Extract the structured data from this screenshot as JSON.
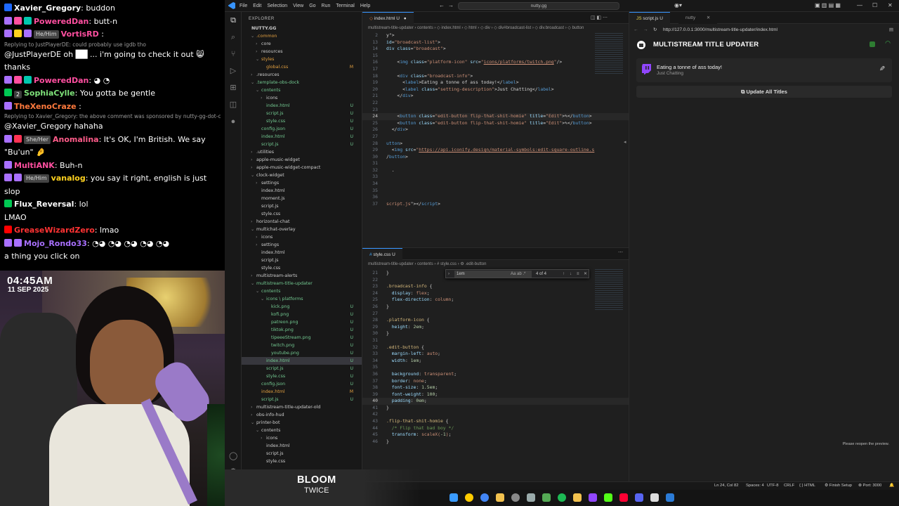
{
  "chat": {
    "messages": [
      {
        "user": "Xavier_Gregory",
        "color": "#ffffff",
        "text": ": buddon",
        "badges": [
          "#1e69ff"
        ]
      },
      {
        "user": "PoweredDan",
        "color": "#ff4fa0",
        "text": ": butt-n",
        "badges": [
          "#a970ff",
          "#ff4fa0",
          "#00c8af"
        ]
      },
      {
        "user": "VortisRD",
        "color": "#ff4fa0",
        "text": " :",
        "badges": [
          "#a970ff",
          "#ffd21f",
          "#a970ff"
        ],
        "pronoun": "He/Him"
      },
      {
        "reply": "Replying to JustPlayerDE: could probably use igdb tho"
      },
      {
        "plain": "@JustPlayerDE oh ██ ... i'm going to check it out 😸 thanks"
      },
      {
        "user": "PoweredDan",
        "color": "#ff4fa0",
        "text": ": ◕ ◔",
        "badges": [
          "#a970ff",
          "#ff4fa0",
          "#00c8af"
        ]
      },
      {
        "user": "SophiaCylle",
        "color": "#7fe37a",
        "text": ": You gotta be gentle",
        "badges": [
          "#00c853",
          "#3d3d3d"
        ],
        "badge_text": "2"
      },
      {
        "user": "TheXenoCraze",
        "color": "#ff7a3d",
        "text": " :",
        "badges": [
          "#a970ff"
        ]
      },
      {
        "reply": "Replying to Xavier_Gregory: the above comment was sponsored by nutty-gg-dot-com-dot-org-dot-dott"
      },
      {
        "plain": "@Xavier_Gregory hahaha"
      },
      {
        "user": "Anomalina",
        "color": "#ff5c8a",
        "text": ": It's OK, I'm British. We say \"Bu'un\" 🤌",
        "badges": [
          "#a970ff",
          "#ff3355"
        ],
        "pronoun": "She/Her"
      },
      {
        "user": "MultiANK",
        "color": "#ff4fa0",
        "text": ": Buh-n",
        "badges": [
          "#a970ff"
        ]
      },
      {
        "user": "vanalog",
        "color": "#ffd21f",
        "text": ": you say it right, english is just slop",
        "badges": [
          "#a970ff",
          "#a970ff"
        ],
        "pronoun": "He/Him"
      },
      {
        "user": "Flux_Reversal",
        "color": "#ffffff",
        "text": ": lol",
        "badges": [
          "#00c853"
        ]
      },
      {
        "plain": "LMAO"
      },
      {
        "user": "GreaseWizardZero",
        "color": "#ff3333",
        "text": ": lmao",
        "badges": [
          "#ff0000"
        ]
      },
      {
        "user": "Mojo_Rondo33",
        "color": "#a970ff",
        "text": ": ◔◕ ◔◕ ◔◕ ◔◕ ◔◕",
        "badges": [
          "#a970ff",
          "#a970ff"
        ]
      },
      {
        "plain": "a thing you click on"
      }
    ]
  },
  "stream": {
    "time": "04:45AM",
    "date": "11 SEP 2025"
  },
  "now_playing": {
    "title": "BLOOM",
    "artist": "TWICE"
  },
  "vscode": {
    "menu": [
      "File",
      "Edit",
      "Selection",
      "View",
      "Go",
      "Run",
      "Terminal",
      "Help"
    ],
    "command_center": "nutty.gg",
    "explorer_title": "EXPLORER",
    "tree": [
      {
        "label": "NUTTY.GG",
        "indent": 0,
        "color": "#cccccc",
        "bold": true
      },
      {
        "label": ".common",
        "indent": 1,
        "color": "#e3a040",
        "folder": true,
        "open": true
      },
      {
        "label": "core",
        "indent": 2,
        "color": "#cccccc",
        "folder": true
      },
      {
        "label": "resources",
        "indent": 2,
        "color": "#cccccc",
        "folder": true
      },
      {
        "label": "styles",
        "indent": 2,
        "color": "#e3a040",
        "folder": true,
        "open": true
      },
      {
        "label": "global.css",
        "indent": 3,
        "color": "#e3a040",
        "status": "M",
        "scolor": "#e3a040"
      },
      {
        "label": ".resources",
        "indent": 1,
        "color": "#cccccc",
        "folder": true
      },
      {
        "label": ".template-obs-dock",
        "indent": 1,
        "color": "#73c991",
        "folder": true,
        "open": true
      },
      {
        "label": "contents",
        "indent": 2,
        "color": "#73c991",
        "folder": true,
        "open": true
      },
      {
        "label": "icons",
        "indent": 3,
        "color": "#cccccc",
        "folder": true
      },
      {
        "label": "index.html",
        "indent": 3,
        "color": "#73c991",
        "status": "U",
        "scolor": "#73c991"
      },
      {
        "label": "script.js",
        "indent": 3,
        "color": "#73c991",
        "status": "U",
        "scolor": "#73c991"
      },
      {
        "label": "style.css",
        "indent": 3,
        "color": "#73c991",
        "status": "U",
        "scolor": "#73c991"
      },
      {
        "label": "config.json",
        "indent": 2,
        "color": "#73c991",
        "status": "U",
        "scolor": "#73c991"
      },
      {
        "label": "index.html",
        "indent": 2,
        "color": "#73c991",
        "status": "U",
        "scolor": "#73c991"
      },
      {
        "label": "script.js",
        "indent": 2,
        "color": "#73c991",
        "status": "U",
        "scolor": "#73c991"
      },
      {
        "label": ".utilities",
        "indent": 1,
        "color": "#cccccc",
        "folder": true
      },
      {
        "label": "apple-music-widget",
        "indent": 1,
        "color": "#cccccc",
        "folder": true
      },
      {
        "label": "apple-music-widget-compact",
        "indent": 1,
        "color": "#cccccc",
        "folder": true
      },
      {
        "label": "clock-widget",
        "indent": 1,
        "color": "#cccccc",
        "folder": true,
        "open": true
      },
      {
        "label": "settings",
        "indent": 2,
        "color": "#cccccc",
        "folder": true
      },
      {
        "label": "index.html",
        "indent": 2,
        "color": "#cccccc"
      },
      {
        "label": "moment.js",
        "indent": 2,
        "color": "#cccccc"
      },
      {
        "label": "script.js",
        "indent": 2,
        "color": "#cccccc"
      },
      {
        "label": "style.css",
        "indent": 2,
        "color": "#cccccc"
      },
      {
        "label": "horizontal-chat",
        "indent": 1,
        "color": "#cccccc",
        "folder": true
      },
      {
        "label": "multichat-overlay",
        "indent": 1,
        "color": "#cccccc",
        "folder": true,
        "open": true
      },
      {
        "label": "icons",
        "indent": 2,
        "color": "#cccccc",
        "folder": true
      },
      {
        "label": "settings",
        "indent": 2,
        "color": "#cccccc",
        "folder": true
      },
      {
        "label": "index.html",
        "indent": 2,
        "color": "#cccccc"
      },
      {
        "label": "script.js",
        "indent": 2,
        "color": "#cccccc"
      },
      {
        "label": "style.css",
        "indent": 2,
        "color": "#cccccc"
      },
      {
        "label": "multistream-alerts",
        "indent": 1,
        "color": "#cccccc",
        "folder": true
      },
      {
        "label": "multistream-title-updater",
        "indent": 1,
        "color": "#73c991",
        "folder": true,
        "open": true
      },
      {
        "label": "contents",
        "indent": 2,
        "color": "#73c991",
        "folder": true,
        "open": true
      },
      {
        "label": "icons \\ platforms",
        "indent": 3,
        "color": "#73c991",
        "folder": true,
        "open": true
      },
      {
        "label": "kick.png",
        "indent": 4,
        "color": "#73c991",
        "status": "U",
        "scolor": "#73c991"
      },
      {
        "label": "kofi.png",
        "indent": 4,
        "color": "#73c991",
        "status": "U",
        "scolor": "#73c991"
      },
      {
        "label": "patreon.png",
        "indent": 4,
        "color": "#73c991",
        "status": "U",
        "scolor": "#73c991"
      },
      {
        "label": "tiktok.png",
        "indent": 4,
        "color": "#73c991",
        "status": "U",
        "scolor": "#73c991"
      },
      {
        "label": "tipeeeStream.png",
        "indent": 4,
        "color": "#73c991",
        "status": "U",
        "scolor": "#73c991"
      },
      {
        "label": "twitch.png",
        "indent": 4,
        "color": "#73c991",
        "status": "U",
        "scolor": "#73c991"
      },
      {
        "label": "youtube.png",
        "indent": 4,
        "color": "#73c991",
        "status": "U",
        "scolor": "#73c991"
      },
      {
        "label": "index.html",
        "indent": 3,
        "color": "#73c991",
        "status": "U",
        "scolor": "#73c991",
        "selected": true
      },
      {
        "label": "script.js",
        "indent": 3,
        "color": "#73c991",
        "status": "U",
        "scolor": "#73c991"
      },
      {
        "label": "style.css",
        "indent": 3,
        "color": "#73c991",
        "status": "U",
        "scolor": "#73c991"
      },
      {
        "label": "config.json",
        "indent": 2,
        "color": "#73c991",
        "status": "U",
        "scolor": "#73c991"
      },
      {
        "label": "index.html",
        "indent": 2,
        "color": "#e3a040",
        "status": "M",
        "scolor": "#e3a040"
      },
      {
        "label": "script.js",
        "indent": 2,
        "color": "#73c991",
        "status": "U",
        "scolor": "#73c991"
      },
      {
        "label": "multistream-title-updater-old",
        "indent": 1,
        "color": "#cccccc",
        "folder": true
      },
      {
        "label": "obs-info-hud",
        "indent": 1,
        "color": "#cccccc",
        "folder": true
      },
      {
        "label": "printer-bot",
        "indent": 1,
        "color": "#cccccc",
        "folder": true,
        "open": true
      },
      {
        "label": "contents",
        "indent": 2,
        "color": "#cccccc",
        "folder": true,
        "open": true
      },
      {
        "label": "icons",
        "indent": 3,
        "color": "#cccccc",
        "folder": true
      },
      {
        "label": "index.html",
        "indent": 3,
        "color": "#cccccc"
      },
      {
        "label": "script.js",
        "indent": 3,
        "color": "#cccccc"
      },
      {
        "label": "style.css",
        "indent": 3,
        "color": "#cccccc"
      }
    ],
    "editor_top": {
      "tab": "index.html  U",
      "breadcrumb": "multistream-title-updater › contents › ◇ index.html › ◇ html › ◇ div › ◇ div#broadcast-list › ◇ div.broadcast › ◇ button",
      "lines": [
        {
          "n": "2",
          "html": "<span class='t-txt'>y\"></span>"
        },
        {
          "n": "13",
          "html": "<span class='t-attr'>id</span><span class='t-txt'>=</span><span class='t-str'>\"broadcast-list\"</span><span class='t-txt'>&gt;</span>"
        },
        {
          "n": "14",
          "html": "<span class='t-attr'>div</span> <span class='t-attr'>class</span><span class='t-txt'>=</span><span class='t-str'>\"broadcast\"</span><span class='t-txt'>&gt;</span>"
        },
        {
          "n": "15",
          "html": ""
        },
        {
          "n": "16",
          "html": "    <span class='t-txt'>&lt;</span><span class='t-tag'>img</span> <span class='t-attr'>class</span>=<span class='t-str'>\"platform-icon\"</span> <span class='t-attr'>src</span>=<span class='t-str'>\"<u>icons/platforms/twitch.png</u>\"</span><span class='t-txt'>/&gt;</span>"
        },
        {
          "n": "17",
          "html": ""
        },
        {
          "n": "18",
          "html": "    <span class='t-txt'>&lt;</span><span class='t-tag'>div</span> <span class='t-attr'>class</span>=<span class='t-str'>\"broadcast-info\"</span><span class='t-txt'>&gt;</span>"
        },
        {
          "n": "19",
          "html": "      <span class='t-txt'>&lt;</span><span class='t-tag'>label</span><span class='t-txt'>&gt;Eating a tonne of ass today!&lt;/</span><span class='t-tag'>label</span><span class='t-txt'>&gt;</span>"
        },
        {
          "n": "20",
          "html": "      <span class='t-txt'>&lt;</span><span class='t-tag'>label</span> <span class='t-attr'>class</span>=<span class='t-str'>\"setting-description\"</span><span class='t-txt'>&gt;Just Chatting&lt;/</span><span class='t-tag'>label</span><span class='t-txt'>&gt;</span>"
        },
        {
          "n": "21",
          "html": "    <span class='t-txt'>&lt;/</span><span class='t-tag'>div</span><span class='t-txt'>&gt;</span>"
        },
        {
          "n": "22",
          "html": ""
        },
        {
          "n": "23",
          "html": ""
        },
        {
          "n": "24",
          "html": "    <span class='t-txt'>&lt;</span><span class='t-tag'>button</span> <span class='t-attr'>class</span>=<span class='t-str'>\"edit-button flip-that-shit-homie\"</span> <span class='t-attr'>title</span>=<span class='t-str'>\"Edit\"</span><span class='t-txt'>&gt;✎&lt;/</span><span class='t-tag'>button</span><span class='t-txt'>&gt;</span>",
          "cur": true
        },
        {
          "n": "25",
          "html": "    <span class='t-txt'>&lt;</span><span class='t-tag'>button</span> <span class='t-attr'>class</span>=<span class='t-str'>\"edit-button flip-that-shit-homie\"</span> <span class='t-attr'>title</span>=<span class='t-str'>\"Edit\"</span><span class='t-txt'>&gt;✎&lt;/</span><span class='t-tag'>button</span><span class='t-txt'>&gt;</span>"
        },
        {
          "n": "26",
          "html": "  <span class='t-txt'>&lt;/</span><span class='t-tag'>div</span><span class='t-txt'>&gt;</span>"
        },
        {
          "n": "27",
          "html": ""
        },
        {
          "n": "28",
          "html": "<span class='t-tag'>utton</span><span class='t-txt'>&gt;</span>"
        },
        {
          "n": "29",
          "html": "  <span class='t-txt'>&lt;</span><span class='t-tag'>img</span> <span class='t-attr'>src</span>=<span class='t-str'>\"<u>https://api.iconify.design/material-symbols:edit-square-outline.s</u></span>"
        },
        {
          "n": "30",
          "html": "<span class='t-txt'>/</span><span class='t-tag'>button</span><span class='t-txt'>&gt;</span>"
        },
        {
          "n": "31",
          "html": ""
        },
        {
          "n": "32",
          "html": "  <span class='t-txt'>.</span>"
        },
        {
          "n": "33",
          "html": ""
        },
        {
          "n": "34",
          "html": ""
        },
        {
          "n": "35",
          "html": ""
        },
        {
          "n": "36",
          "html": ""
        },
        {
          "n": "37",
          "html": "<span class='t-str'>script.js</span><span class='t-txt'>\"&gt;&lt;/</span><span class='t-tag'>script</span><span class='t-txt'>&gt;</span>"
        }
      ]
    },
    "editor_bottom": {
      "tab": "style.css  U",
      "breadcrumb": "multistream-title-updater › contents › # style.css › ⚙ .edit-button",
      "find": {
        "query": "1em",
        "result": "4 of 4"
      },
      "lines": [
        {
          "n": "21",
          "html": "<span class='t-txt'>}</span>"
        },
        {
          "n": "22",
          "html": ""
        },
        {
          "n": "23",
          "html": "<span class='t-sel'>.broadcast-info</span> <span class='t-txt'>{</span>"
        },
        {
          "n": "24",
          "html": "  <span class='t-prop'>display</span><span class='t-txt'>:</span> <span class='t-val'>flex</span><span class='t-txt'>;</span>"
        },
        {
          "n": "25",
          "html": "  <span class='t-prop'>flex-direction</span><span class='t-txt'>:</span> <span class='t-val'>column</span><span class='t-txt'>;</span>"
        },
        {
          "n": "26",
          "html": "<span class='t-txt'>}</span>"
        },
        {
          "n": "27",
          "html": ""
        },
        {
          "n": "28",
          "html": "<span class='t-sel'>.platform-icon</span> <span class='t-txt'>{</span>"
        },
        {
          "n": "29",
          "html": "  <span class='t-prop'>height</span><span class='t-txt'>:</span> <span class='t-num'>2em</span><span class='t-txt'>;</span>"
        },
        {
          "n": "30",
          "html": "<span class='t-txt'>}</span>"
        },
        {
          "n": "31",
          "html": ""
        },
        {
          "n": "32",
          "html": "<span class='t-sel'>.edit-button</span> <span class='t-txt'>{</span>"
        },
        {
          "n": "33",
          "html": "  <span class='t-prop'>margin-left</span><span class='t-txt'>:</span> <span class='t-val'>auto</span><span class='t-txt'>;</span>"
        },
        {
          "n": "34",
          "html": "  <span class='t-prop'>width</span><span class='t-txt'>:</span> <span class='t-num'>1em</span><span class='t-txt'>;</span>"
        },
        {
          "n": "35",
          "html": ""
        },
        {
          "n": "36",
          "html": "  <span class='t-prop'>background</span><span class='t-txt'>:</span> <span class='t-val'>transparent</span><span class='t-txt'>;</span>"
        },
        {
          "n": "37",
          "html": "  <span class='t-prop'>border</span><span class='t-txt'>:</span> <span class='t-val'>none</span><span class='t-txt'>;</span>"
        },
        {
          "n": "38",
          "html": "  <span class='t-prop'>font-size</span><span class='t-txt'>:</span> <span class='t-num'>1.5em</span><span class='t-txt'>;</span>"
        },
        {
          "n": "39",
          "html": "  <span class='t-prop'>font-weight</span><span class='t-txt'>:</span> <span class='t-num'>100</span><span class='t-txt'>;</span>"
        },
        {
          "n": "40",
          "html": "  <span class='t-prop'>padding</span><span class='t-txt'>:</span> <span class='t-num'>0em</span><span class='t-txt'>;</span>",
          "cur": true
        },
        {
          "n": "41",
          "html": "<span class='t-txt'>}</span>"
        },
        {
          "n": "42",
          "html": ""
        },
        {
          "n": "43",
          "html": "<span class='t-sel'>.flip-that-shit-homie</span> <span class='t-txt'>{</span>"
        },
        {
          "n": "44",
          "html": "  <span class='t-com'>/* Flip that bad boy */</span>"
        },
        {
          "n": "45",
          "html": "  <span class='t-prop'>transform</span><span class='t-txt'>:</span> <span class='t-val'>scaleX(</span><span class='t-num'>-1</span><span class='t-val'>)</span><span class='t-txt'>;</span>"
        },
        {
          "n": "46",
          "html": "<span class='t-txt'>}</span>"
        }
      ]
    },
    "preview": {
      "tabs": [
        "script.js  U",
        "nutty"
      ],
      "url": "http://127.0.0.1:3000/multistream-title-updater/index.html",
      "app_title": "MULTISTREAM TITLE UPDATER",
      "broadcast_title": "Eating a tonne of ass today!",
      "broadcast_category": "Just Chatting",
      "update_button": "Update All Titles",
      "reopen_note": "Please reopen the preview."
    },
    "status": {
      "position": "Ln 24, Col 82",
      "spaces": "Spaces: 4",
      "encoding": "UTF-8",
      "eol": "CRLF",
      "language": "{ } HTML",
      "finish": "⚙ Finish Setup",
      "port": "⊗ Port: 3000"
    },
    "colors": {
      "accent": "#3794ff",
      "twitch": "#9146ff",
      "added": "#73c991",
      "modified": "#e3a040"
    }
  }
}
